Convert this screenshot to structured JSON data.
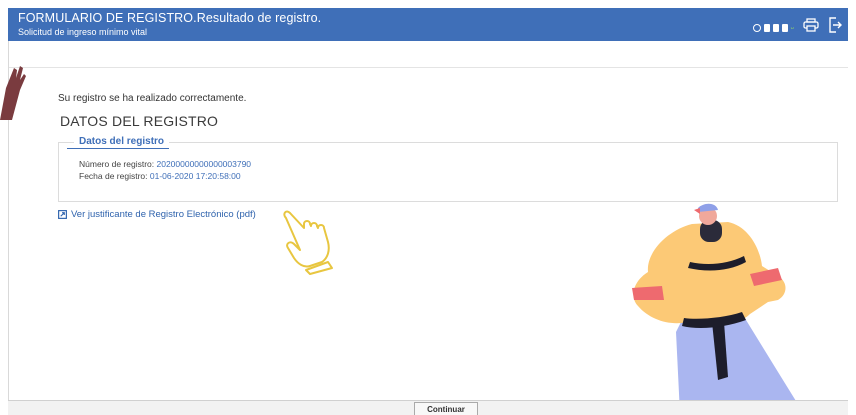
{
  "header": {
    "title": "FORMULARIO DE REGISTRO.Resultado de registro.",
    "subtitle": "Solicitud de ingreso mínimo vital",
    "color": "#3f6fb8"
  },
  "main": {
    "success_message": "Su registro se ha realizado correctamente.",
    "section_title": "DATOS DEL REGISTRO",
    "box": {
      "legend": "Datos del registro",
      "fields": [
        {
          "label": "Número de registro: ",
          "value": "20200000000000003790"
        },
        {
          "label": "Fecha de registro: ",
          "value": "01-06-2020  17:20:58:00"
        }
      ]
    },
    "link_label": "Ver justificante de Registro Electrónico (pdf)"
  },
  "footer": {
    "continue_label": "Continuar"
  },
  "icons": [
    "globe-icon",
    "flag-icon",
    "print-icon",
    "exit-icon",
    "external-link-icon"
  ]
}
